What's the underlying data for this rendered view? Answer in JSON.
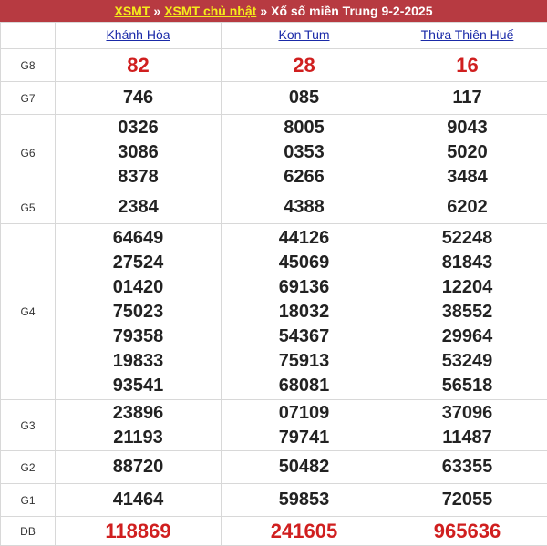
{
  "header": {
    "link1": "XSMT",
    "sep1": "»",
    "link2": "XSMT chủ nhật",
    "sep2": "»",
    "title": "Xổ số miền Trung 9-2-2025"
  },
  "provinces": [
    "Khánh Hòa",
    "Kon Tum",
    "Thừa Thiên Huế"
  ],
  "rows": [
    {
      "label": "G8",
      "style": "red",
      "values": [
        [
          "82"
        ],
        [
          "28"
        ],
        [
          "16"
        ]
      ]
    },
    {
      "label": "G7",
      "style": "normal",
      "values": [
        [
          "746"
        ],
        [
          "085"
        ],
        [
          "117"
        ]
      ]
    },
    {
      "label": "G6",
      "style": "normal",
      "values": [
        [
          "0326",
          "3086",
          "8378"
        ],
        [
          "8005",
          "0353",
          "6266"
        ],
        [
          "9043",
          "5020",
          "3484"
        ]
      ]
    },
    {
      "label": "G5",
      "style": "normal",
      "values": [
        [
          "2384"
        ],
        [
          "4388"
        ],
        [
          "6202"
        ]
      ]
    },
    {
      "label": "G4",
      "style": "normal",
      "values": [
        [
          "64649",
          "27524",
          "01420",
          "75023",
          "79358",
          "19833",
          "93541"
        ],
        [
          "44126",
          "45069",
          "69136",
          "18032",
          "54367",
          "75913",
          "68081"
        ],
        [
          "52248",
          "81843",
          "12204",
          "38552",
          "29964",
          "53249",
          "56518"
        ]
      ]
    },
    {
      "label": "G3",
      "style": "normal",
      "values": [
        [
          "23896",
          "21193"
        ],
        [
          "07109",
          "79741"
        ],
        [
          "37096",
          "11487"
        ]
      ]
    },
    {
      "label": "G2",
      "style": "normal",
      "values": [
        [
          "88720"
        ],
        [
          "50482"
        ],
        [
          "63355"
        ]
      ]
    },
    {
      "label": "G1",
      "style": "normal",
      "values": [
        [
          "41464"
        ],
        [
          "59853"
        ],
        [
          "72055"
        ]
      ]
    },
    {
      "label": "ĐB",
      "style": "red",
      "values": [
        [
          "118869"
        ],
        [
          "241605"
        ],
        [
          "965636"
        ]
      ]
    }
  ],
  "colors": {
    "title_bg": "#b73a41",
    "link": "#f5ec1b",
    "highlight": "#d01f1f",
    "province": "#1a2aa8"
  }
}
